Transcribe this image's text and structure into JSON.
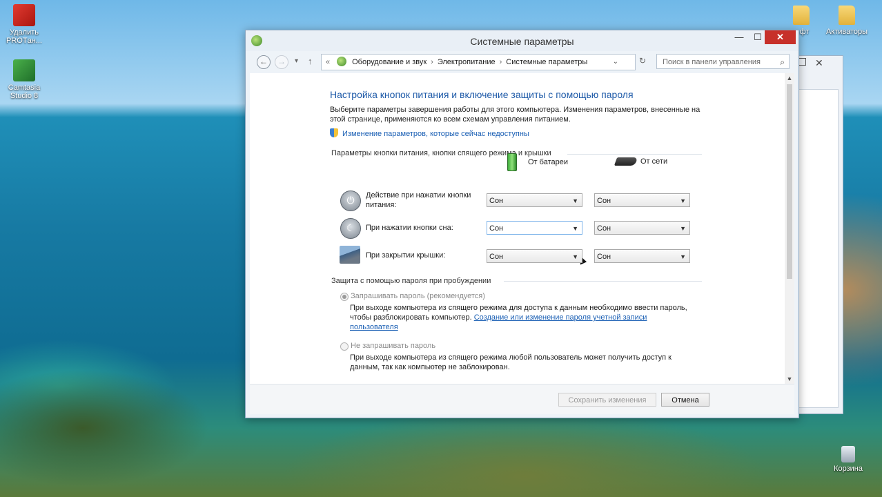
{
  "desktop": {
    "icons_left": [
      {
        "label": "Удалить PROTан...",
        "icon": "uninstall-red-icon"
      },
      {
        "label": "Camtasia Studio 8",
        "icon": "camtasia-icon"
      }
    ],
    "icons_right": [
      {
        "label": "...фт",
        "icon": "folder-icon"
      },
      {
        "label": "Активаторы",
        "icon": "folder-icon"
      }
    ],
    "recycle_bin": "Корзина"
  },
  "window": {
    "title": "Системные параметры",
    "controls": {
      "minimize": "—",
      "maximize": "☐",
      "close": "✕"
    }
  },
  "navbar": {
    "back": "←",
    "forward": "→",
    "recent": "▾",
    "up": "↑",
    "breadcrumb": {
      "prefix": "«",
      "items": [
        "Оборудование и звук",
        "Электропитание",
        "Системные параметры"
      ],
      "separator": "›"
    },
    "dropdown": "⌄",
    "refresh": "↻",
    "search_placeholder": "Поиск в панели управления"
  },
  "content": {
    "heading": "Настройка кнопок питания и включение защиты с помощью пароля",
    "description": "Выберите параметры завершения работы для этого компьютера. Изменения параметров, внесенные на этой странице, применяются ко всем схемам управления питанием.",
    "unavailable_link": "Изменение параметров, которые сейчас недоступны",
    "power_group_title": "Параметры кнопки питания, кнопки спящего режима и крышки",
    "col_battery": "От батареи",
    "col_plugged": "От сети",
    "rows": [
      {
        "label": "Действие при нажатии кнопки питания:",
        "battery": "Сон",
        "plugged": "Сон"
      },
      {
        "label": "При нажатии кнопки сна:",
        "battery": "Сон",
        "plugged": "Сон"
      },
      {
        "label": "При закрытии крышки:",
        "battery": "Сон",
        "plugged": "Сон"
      }
    ],
    "password_group_title": "Защита с помощью пароля при пробуждении",
    "radio_require": {
      "label": "Запрашивать пароль (рекомендуется)",
      "desc": "При выходе компьютера из спящего режима для доступа к данным необходимо ввести пароль, чтобы разблокировать компьютер.",
      "link": "Создание или изменение пароля учетной записи пользователя"
    },
    "radio_no_require": {
      "label": "Не запрашивать пароль",
      "desc": "При выходе компьютера из спящего режима любой пользователь может получить доступ к данным, так как компьютер не заблокирован."
    }
  },
  "footer": {
    "save": "Сохранить изменения",
    "cancel": "Отмена"
  },
  "colors": {
    "heading": "#1e5aa8",
    "link": "#1a5fb4",
    "close_button": "#c7302a"
  }
}
